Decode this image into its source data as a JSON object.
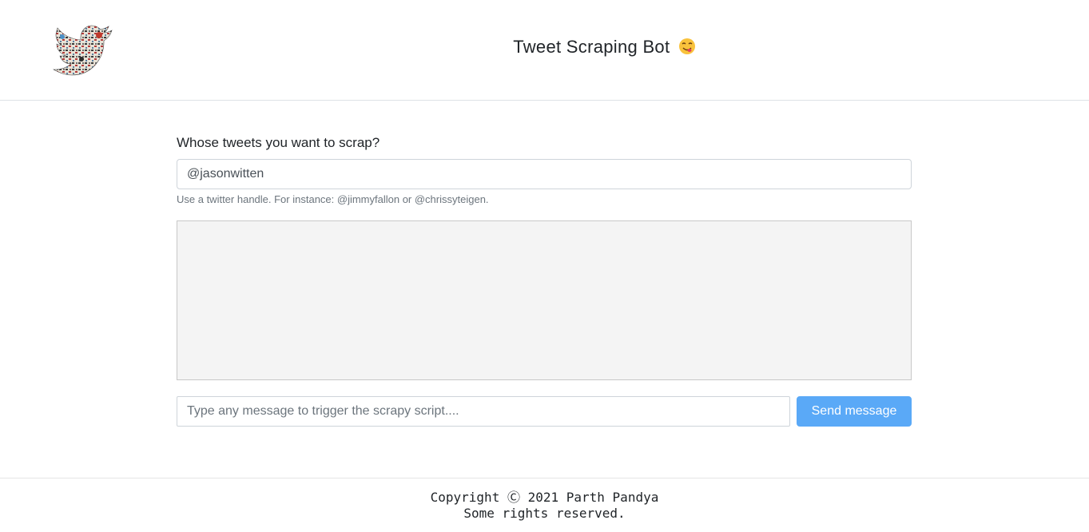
{
  "header": {
    "title": "Tweet Scraping Bot",
    "emoji": "😋",
    "logo_icon": "twitter-bird-collage-icon"
  },
  "form": {
    "question_label": "Whose tweets you want to scrap?",
    "handle_value": "@jasonwitten",
    "handle_help": "Use a twitter handle. For instance: @jimmyfallon or @chrissyteigen.",
    "message_placeholder": "Type any message to trigger the scrapy script....",
    "send_label": "Send message"
  },
  "footer": {
    "copyright": "Copyright Ⓒ 2021 Parth Pandya",
    "rights": "Some rights reserved."
  },
  "colors": {
    "accent_button": "#5aa9f7",
    "output_bg": "#f4f4f4"
  }
}
